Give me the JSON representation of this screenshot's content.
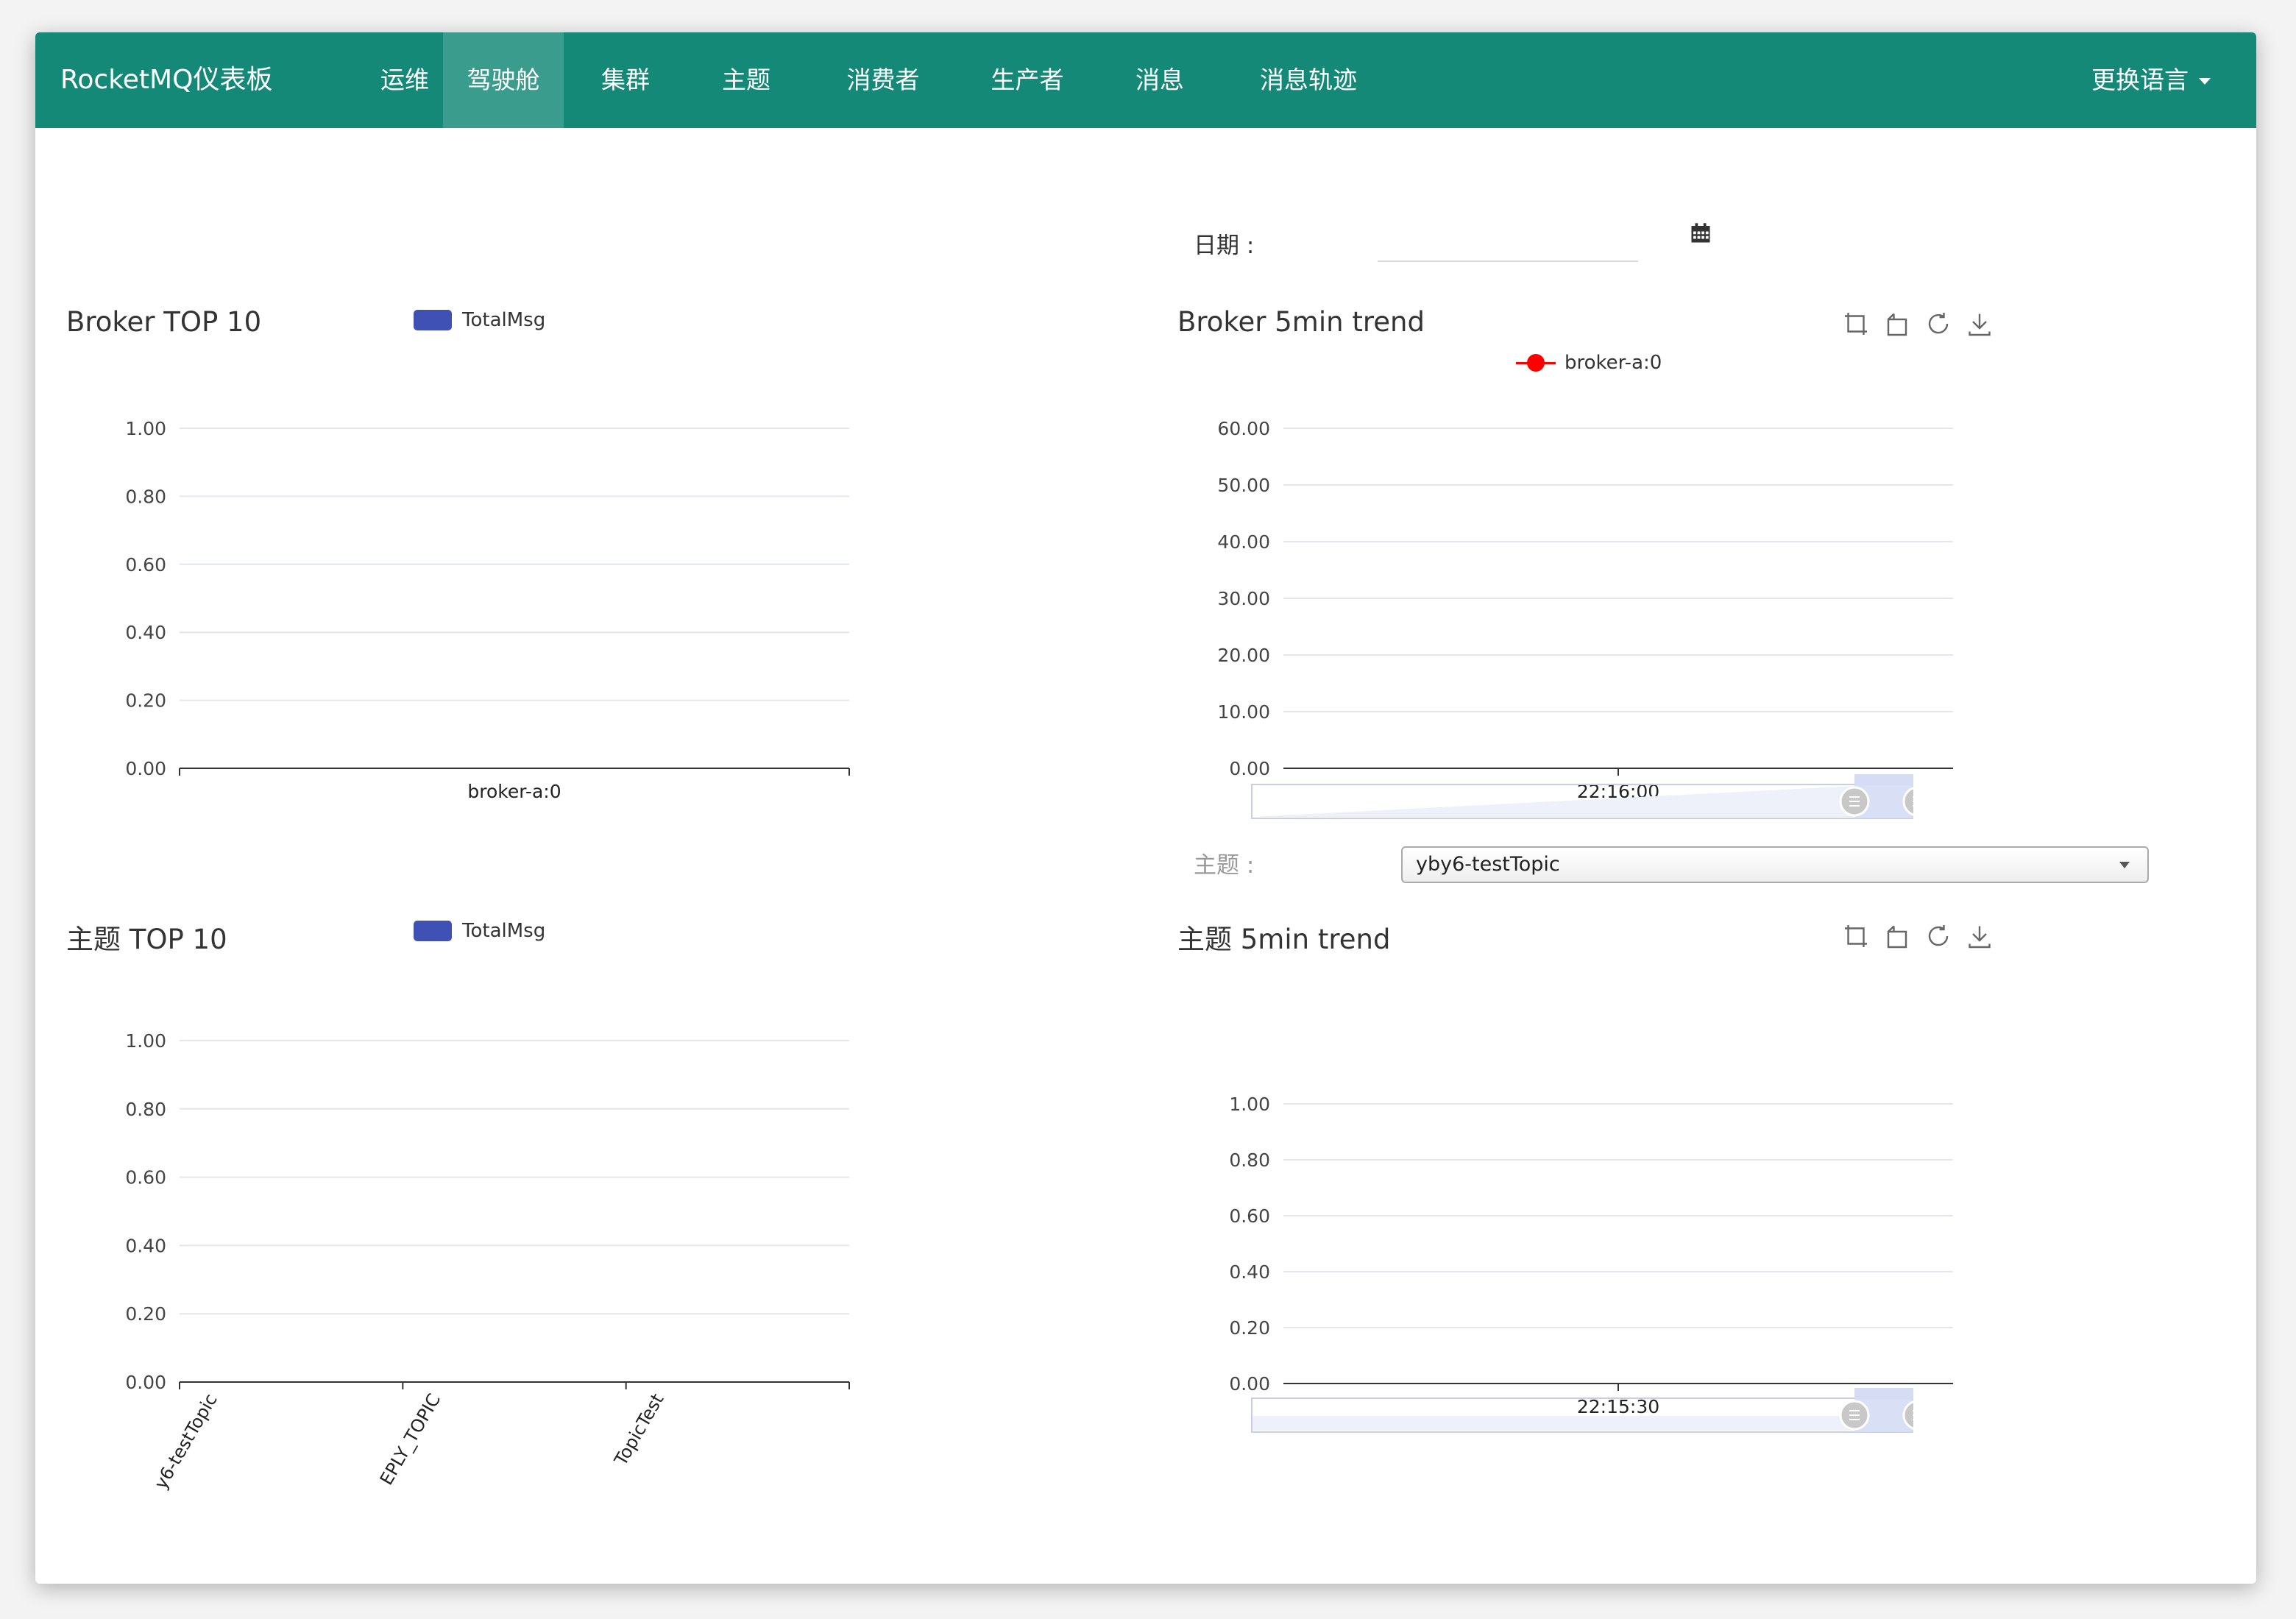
{
  "navbar": {
    "brand": "RocketMQ仪表板",
    "items": [
      {
        "label": "运维",
        "active": false
      },
      {
        "label": "驾驶舱",
        "active": true
      },
      {
        "label": "集群",
        "active": false
      },
      {
        "label": "主题",
        "active": false
      },
      {
        "label": "消费者",
        "active": false
      },
      {
        "label": "生产者",
        "active": false
      },
      {
        "label": "消息",
        "active": false
      },
      {
        "label": "消息轨迹",
        "active": false
      }
    ],
    "language": "更换语言"
  },
  "date_filter": {
    "label": "日期 :",
    "value": ""
  },
  "topic_filter": {
    "label": "主题 :",
    "selected": "yby6-testTopic"
  },
  "colors": {
    "header": "#148977",
    "bar_series": "#3f51b5",
    "line_series": "#ff0000"
  },
  "icons": [
    "calendar-icon",
    "zoom-icon",
    "zoom-reset-icon",
    "restore-icon",
    "download-icon"
  ],
  "chart_data": [
    {
      "id": "broker_top10",
      "type": "bar",
      "title": "Broker TOP 10",
      "legend": [
        "TotalMsg"
      ],
      "categories": [
        "broker-a:0"
      ],
      "series": [
        {
          "name": "TotalMsg",
          "values": [
            0
          ]
        }
      ],
      "ylim": [
        0,
        1
      ],
      "y_ticks": [
        "1.00",
        "0.80",
        "0.60",
        "0.40",
        "0.20",
        "0.00"
      ]
    },
    {
      "id": "broker_5min",
      "type": "line",
      "title": "Broker 5min trend",
      "legend": [
        "broker-a:0"
      ],
      "x": [
        "22:16:00"
      ],
      "series": [
        {
          "name": "broker-a:0",
          "values": []
        }
      ],
      "ylim": [
        0,
        60
      ],
      "y_ticks": [
        "60.00",
        "50.00",
        "40.00",
        "30.00",
        "20.00",
        "10.00",
        "0.00"
      ],
      "grid": true
    },
    {
      "id": "topic_top10",
      "type": "bar",
      "title": "主题 TOP 10",
      "legend": [
        "TotalMsg"
      ],
      "categories": [
        "y6-testTopic",
        "EPLY_TOPIC",
        "TopicTest"
      ],
      "series": [
        {
          "name": "TotalMsg",
          "values": [
            0,
            0,
            0
          ]
        }
      ],
      "ylim": [
        0,
        1
      ],
      "y_ticks": [
        "1.00",
        "0.80",
        "0.60",
        "0.40",
        "0.20",
        "0.00"
      ]
    },
    {
      "id": "topic_5min",
      "type": "line",
      "title": "主题 5min trend",
      "legend": [],
      "x": [
        "22:15:30"
      ],
      "series": [],
      "ylim": [
        0,
        1
      ],
      "y_ticks": [
        "1.00",
        "0.80",
        "0.60",
        "0.40",
        "0.20",
        "0.00"
      ],
      "grid": true
    }
  ]
}
